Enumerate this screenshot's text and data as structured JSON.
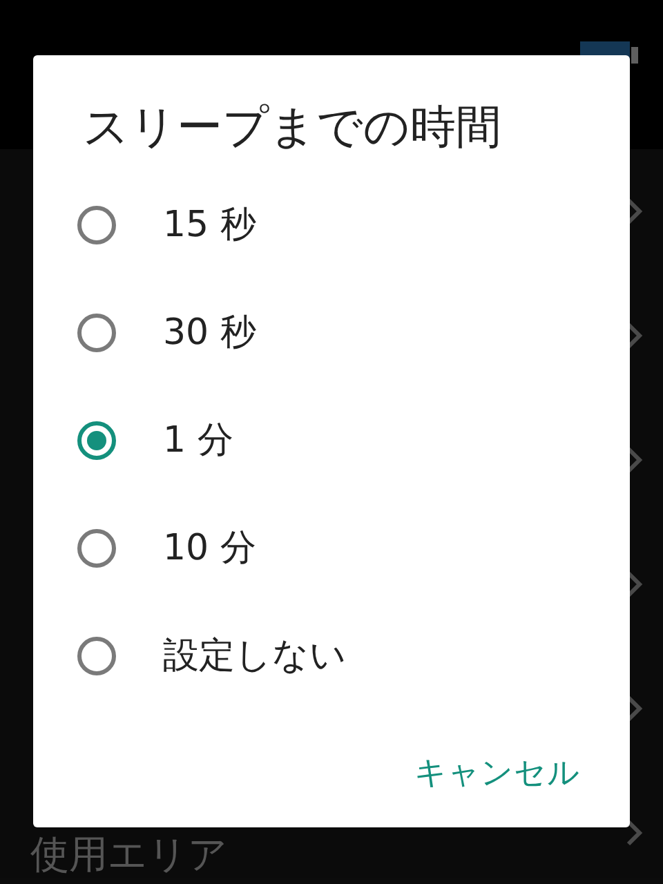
{
  "background_list": {
    "last_item": "使用エリア"
  },
  "dialog": {
    "title": "スリープまでの時間",
    "options": [
      {
        "label": "15 秒",
        "selected": false
      },
      {
        "label": "30 秒",
        "selected": false
      },
      {
        "label": "1 分",
        "selected": true
      },
      {
        "label": "10 分",
        "selected": false
      },
      {
        "label": "設定しない",
        "selected": false
      }
    ],
    "buttons": [
      "キャンセル"
    ]
  }
}
